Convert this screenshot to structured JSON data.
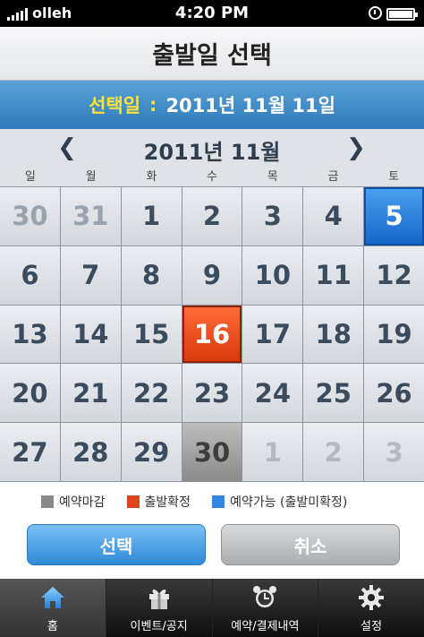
{
  "status_bar": {
    "carrier": "olleh",
    "time": "4:20 PM",
    "icons": [
      "signal-icon",
      "alarm-clock-icon",
      "battery-icon"
    ]
  },
  "header": {
    "title": "출발일 선택"
  },
  "selected": {
    "label": "선택일",
    "colon": ":",
    "value": "2011년 11월 11일"
  },
  "calendar": {
    "month_title": "2011년 11월",
    "prev_icon": "chevron-left-icon",
    "next_icon": "chevron-right-icon",
    "weekdays": [
      "일",
      "월",
      "화",
      "수",
      "목",
      "금",
      "토"
    ],
    "weeks": [
      [
        "30",
        "31",
        "1",
        "2",
        "3",
        "4",
        "5"
      ],
      [
        "6",
        "7",
        "8",
        "9",
        "10",
        "11",
        "12"
      ],
      [
        "13",
        "14",
        "15",
        "16",
        "17",
        "18",
        "19"
      ],
      [
        "20",
        "21",
        "22",
        "23",
        "24",
        "25",
        "26"
      ],
      [
        "27",
        "28",
        "29",
        "30",
        "1",
        "2",
        "3"
      ]
    ]
  },
  "legend": {
    "closed": {
      "label": "예약마감",
      "color": "#8a8a8a"
    },
    "confirmed": {
      "label": "출발확정",
      "color": "#e0451a"
    },
    "available": {
      "label": "예약가능 (출발미확정)",
      "color": "#2f86e6"
    }
  },
  "actions": {
    "select_label": "선택",
    "cancel_label": "취소"
  },
  "tabs": [
    {
      "label": "홈",
      "icon": "home-icon",
      "active": true
    },
    {
      "label": "이벤트/공지",
      "icon": "gift-icon",
      "active": false
    },
    {
      "label": "예약/결제내역",
      "icon": "alarm-clock-icon",
      "active": false
    },
    {
      "label": "설정",
      "icon": "gear-icon",
      "active": false
    }
  ]
}
